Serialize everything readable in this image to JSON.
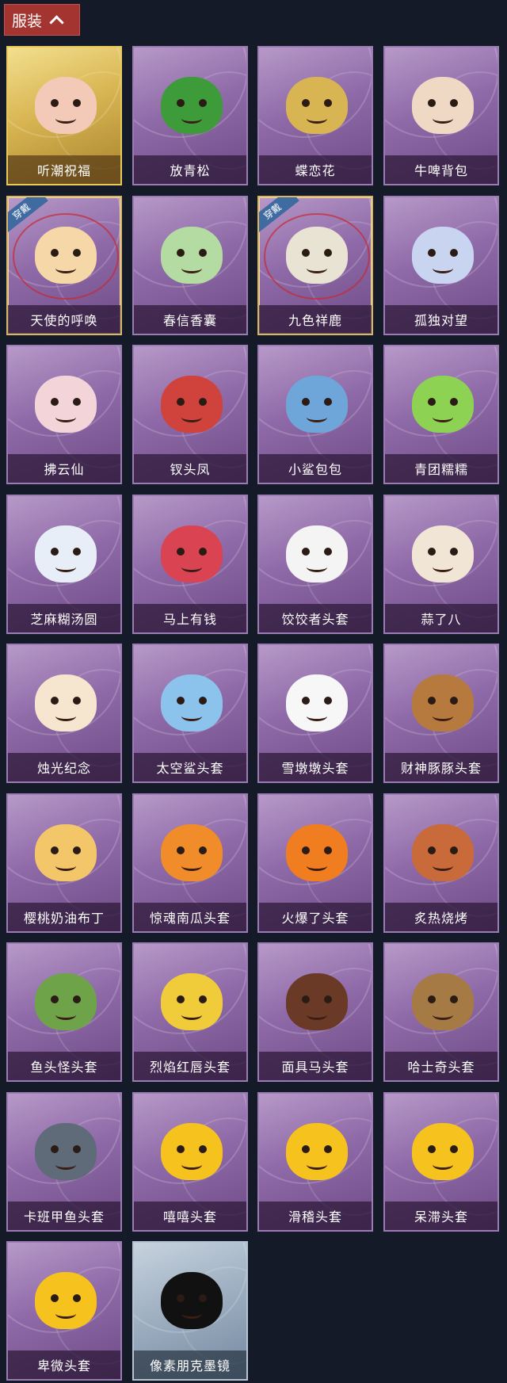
{
  "header": {
    "label": "服装"
  },
  "badge_text": "穿戴",
  "items": [
    {
      "name": "听潮祝福",
      "tier": "gold",
      "equipped": false,
      "icon": "angel-figure-icon",
      "color": "#f3c9b7"
    },
    {
      "name": "放青松",
      "tier": "purple",
      "equipped": false,
      "icon": "bonsai-pine-icon",
      "color": "#3e9b3a"
    },
    {
      "name": "蝶恋花",
      "tier": "purple",
      "equipped": false,
      "icon": "bell-charm-icon",
      "color": "#d8b552"
    },
    {
      "name": "牛啤背包",
      "tier": "purple",
      "equipped": false,
      "icon": "cow-barrel-icon",
      "color": "#f0d9c4"
    },
    {
      "name": "天使的呼唤",
      "tier": "purple",
      "equipped": true,
      "icon": "angel-doll-icon",
      "color": "#f5d7a8"
    },
    {
      "name": "春信香囊",
      "tier": "purple",
      "equipped": false,
      "icon": "sachet-icon",
      "color": "#b4dba1"
    },
    {
      "name": "九色祥鹿",
      "tier": "purple",
      "equipped": true,
      "icon": "deer-charm-icon",
      "color": "#e9e3d4"
    },
    {
      "name": "孤独对望",
      "tier": "purple",
      "equipped": false,
      "icon": "fairy-doll-icon",
      "color": "#c9d5f0"
    },
    {
      "name": "拂云仙",
      "tier": "purple",
      "equipped": false,
      "icon": "cloud-fairy-icon",
      "color": "#f2d4d9"
    },
    {
      "name": "钗头凤",
      "tier": "purple",
      "equipped": false,
      "icon": "phoenix-doll-icon",
      "color": "#d0423c"
    },
    {
      "name": "小鲨包包",
      "tier": "purple",
      "equipped": false,
      "icon": "shark-bag-icon",
      "color": "#6fa6da"
    },
    {
      "name": "青团糯糯",
      "tier": "purple",
      "equipped": false,
      "icon": "green-dumpling-icon",
      "color": "#8ed254"
    },
    {
      "name": "芝麻糊汤圆",
      "tier": "purple",
      "equipped": false,
      "icon": "rice-ball-icon",
      "color": "#e8eef8"
    },
    {
      "name": "马上有钱",
      "tier": "purple",
      "equipped": false,
      "icon": "red-horse-icon",
      "color": "#d94352"
    },
    {
      "name": "饺饺者头套",
      "tier": "purple",
      "equipped": false,
      "icon": "dumpling-head-icon",
      "color": "#f4f4f4"
    },
    {
      "name": "蒜了八",
      "tier": "purple",
      "equipped": false,
      "icon": "garlic-head-icon",
      "color": "#f1e6d6"
    },
    {
      "name": "烛光纪念",
      "tier": "purple",
      "equipped": false,
      "icon": "candle-head-icon",
      "color": "#f6e5cf"
    },
    {
      "name": "太空鲨头套",
      "tier": "purple",
      "equipped": false,
      "icon": "space-shark-icon",
      "color": "#8cc3ec"
    },
    {
      "name": "雪墩墩头套",
      "tier": "purple",
      "equipped": false,
      "icon": "snowman-head-icon",
      "color": "#f7f7f7"
    },
    {
      "name": "财神豚豚头套",
      "tier": "purple",
      "equipped": false,
      "icon": "capybara-head-icon",
      "color": "#b77a3e"
    },
    {
      "name": "樱桃奶油布丁",
      "tier": "purple",
      "equipped": false,
      "icon": "pudding-head-icon",
      "color": "#f3c66a"
    },
    {
      "name": "惊魂南瓜头套",
      "tier": "purple",
      "equipped": false,
      "icon": "pumpkin-head-icon",
      "color": "#f08c2a"
    },
    {
      "name": "火爆了头套",
      "tier": "purple",
      "equipped": false,
      "icon": "fire-head-icon",
      "color": "#f07d1f"
    },
    {
      "name": "炙热烧烤",
      "tier": "purple",
      "equipped": false,
      "icon": "bbq-meat-icon",
      "color": "#c96a3a"
    },
    {
      "name": "鱼头怪头套",
      "tier": "purple",
      "equipped": false,
      "icon": "fish-head-icon",
      "color": "#6fa34a"
    },
    {
      "name": "烈焰红唇头套",
      "tier": "purple",
      "equipped": false,
      "icon": "pikachu-head-icon",
      "color": "#f1cc3a"
    },
    {
      "name": "面具马头套",
      "tier": "purple",
      "equipped": false,
      "icon": "horse-mask-icon",
      "color": "#6b3a26"
    },
    {
      "name": "哈士奇头套",
      "tier": "purple",
      "equipped": false,
      "icon": "husky-head-icon",
      "color": "#a57a45"
    },
    {
      "name": "卡班甲鱼头套",
      "tier": "purple",
      "equipped": false,
      "icon": "whale-head-icon",
      "color": "#5f6b78"
    },
    {
      "name": "嘻嘻头套",
      "tier": "purple",
      "equipped": false,
      "icon": "grin-emoji-icon",
      "color": "#f6c21e"
    },
    {
      "name": "滑稽头套",
      "tier": "purple",
      "equipped": false,
      "icon": "smirk-emoji-icon",
      "color": "#f6c21e"
    },
    {
      "name": "呆滞头套",
      "tier": "purple",
      "equipped": false,
      "icon": "dazed-emoji-icon",
      "color": "#f6c21e"
    },
    {
      "name": "卑微头套",
      "tier": "purple",
      "equipped": false,
      "icon": "humble-emoji-icon",
      "color": "#f6c21e"
    },
    {
      "name": "像素朋克墨镜",
      "tier": "silver",
      "equipped": false,
      "icon": "pixel-sunglasses-icon",
      "color": "#111111"
    }
  ]
}
